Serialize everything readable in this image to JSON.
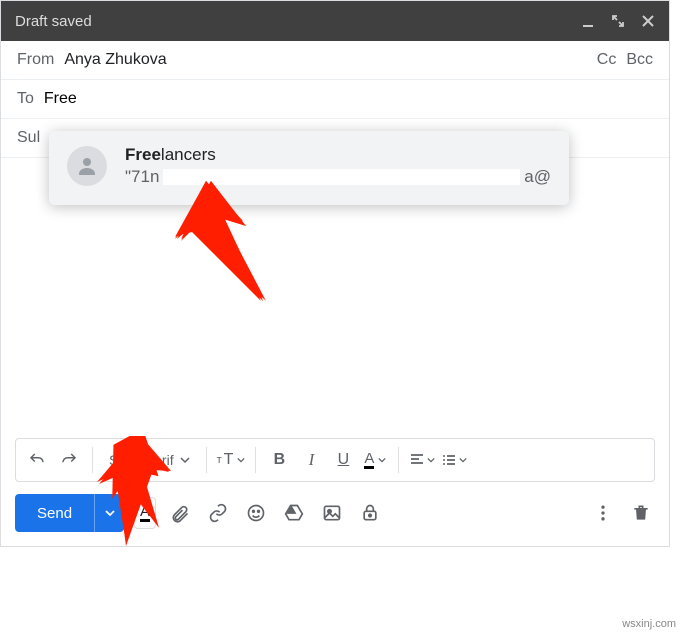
{
  "titlebar": {
    "title": "Draft saved"
  },
  "from": {
    "label": "From",
    "value": "Anya Zhukova",
    "cc": "Cc",
    "bcc": "Bcc"
  },
  "to": {
    "label": "To",
    "value": "Free"
  },
  "subject": {
    "label_prefix": "Sul"
  },
  "autocomplete": {
    "name_match": "Free",
    "name_rest": "lancers",
    "email_start": "\"71n",
    "email_end": "a@"
  },
  "format_toolbar": {
    "font": "Sans Serif"
  },
  "actions": {
    "send": "Send"
  },
  "watermark": "wsxinj.com"
}
